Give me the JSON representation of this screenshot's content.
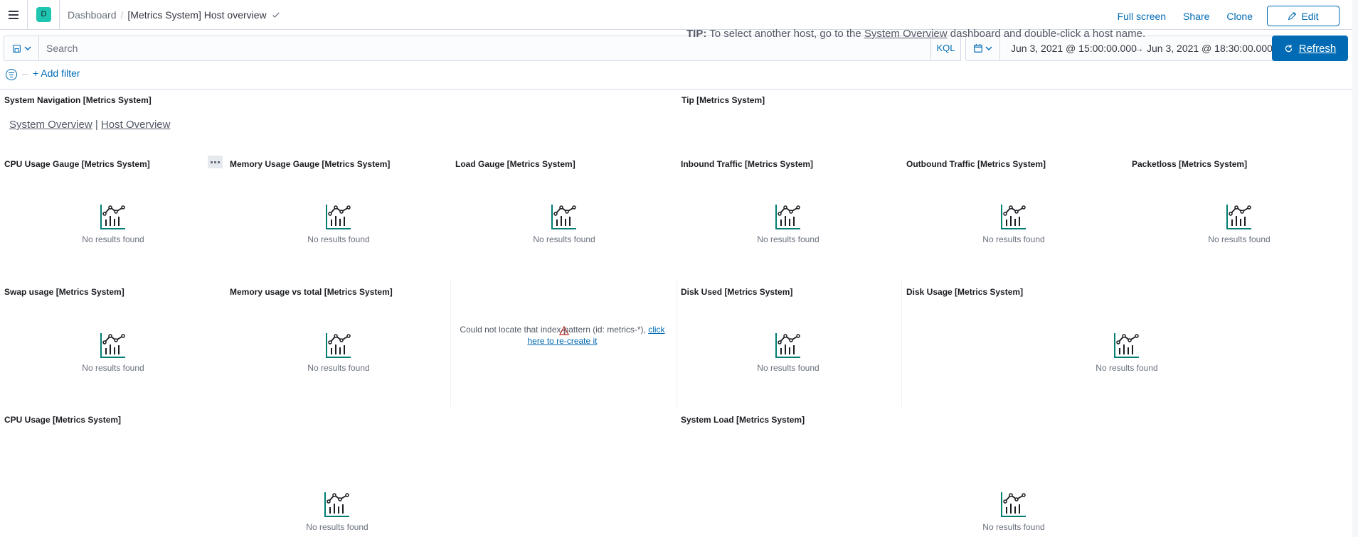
{
  "header": {
    "avatar_letter": "D",
    "breadcrumbs": [
      "Dashboard",
      "[Metrics System] Host overview"
    ],
    "breadcrumb_separator": "/",
    "actions": [
      "Full screen",
      "Share",
      "Clone"
    ],
    "edit_label": "Edit"
  },
  "query": {
    "placeholder": "Search",
    "language": "KQL",
    "date_start": "Jun 3, 2021 @ 15:00:00.000",
    "date_arrow": "→",
    "date_end": "Jun 3, 2021 @ 18:30:00.000",
    "refresh_label": "Refresh"
  },
  "filters": {
    "add_label": "+ Add filter"
  },
  "panels": {
    "system_navigation": {
      "title": "System Navigation [Metrics System]",
      "link1": "System Overview",
      "separator": "|",
      "link2": "Host Overview"
    },
    "tip": {
      "title": "Tip [Metrics System]",
      "label": "TIP:",
      "text_before": "To select another host, go to the",
      "link": "System Overview",
      "text_after": "dashboard and double-click a host name."
    },
    "cpu_gauge": {
      "title": "CPU Usage Gauge [Metrics System]",
      "message": "No results found"
    },
    "memory_gauge": {
      "title": "Memory Usage Gauge [Metrics System]",
      "message": "No results found"
    },
    "load_gauge": {
      "title": "Load Gauge [Metrics System]",
      "message": "No results found"
    },
    "inbound_traffic": {
      "title": "Inbound Traffic [Metrics System]",
      "message": "No results found"
    },
    "outbound_traffic": {
      "title": "Outbound Traffic [Metrics System]",
      "message": "No results found"
    },
    "packetloss": {
      "title": "Packetloss [Metrics System]",
      "message": "No results found"
    },
    "swap_usage": {
      "title": "Swap usage [Metrics System]",
      "message": "No results found"
    },
    "memory_vs_total": {
      "title": "Memory usage vs total [Metrics System]",
      "message": "No results found"
    },
    "index_error": {
      "text": "Could not locate that index-pattern (id: metrics-*),",
      "link": "click here to re-create it"
    },
    "disk_used": {
      "title": "Disk Used [Metrics System]",
      "message": "No results found"
    },
    "disk_usage": {
      "title": "Disk Usage [Metrics System]",
      "message": "No results found"
    },
    "cpu_usage": {
      "title": "CPU Usage [Metrics System]",
      "message": "No results found"
    },
    "system_load": {
      "title": "System Load [Metrics System]",
      "message": "No results found"
    }
  },
  "colors": {
    "accent": "#006bb4",
    "empty_icon": "#017d73",
    "error": "#bd271e",
    "avatar": "#1ec5b0"
  }
}
